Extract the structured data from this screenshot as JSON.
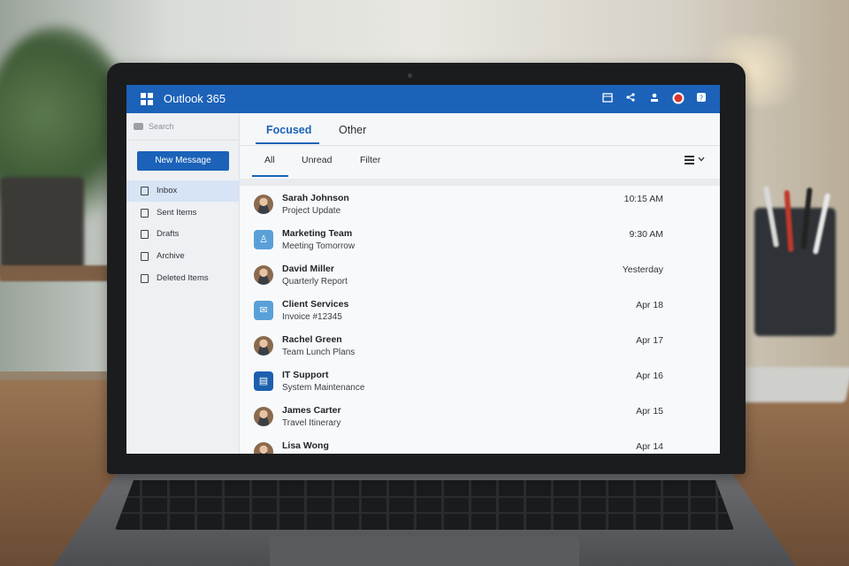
{
  "app": {
    "title": "Outlook 365"
  },
  "topbar_icons": [
    "calendar-icon",
    "share-icon",
    "person-icon",
    "notification-icon",
    "help-icon"
  ],
  "sidebar": {
    "search_placeholder": "Search",
    "new_message_label": "New Message",
    "folders": [
      {
        "label": "Inbox",
        "icon": "inbox-icon",
        "active": true
      },
      {
        "label": "Sent Items",
        "icon": "sent-icon",
        "active": false
      },
      {
        "label": "Drafts",
        "icon": "drafts-icon",
        "active": false
      },
      {
        "label": "Archive",
        "icon": "archive-icon",
        "active": false
      },
      {
        "label": "Deleted Items",
        "icon": "trash-icon",
        "active": false
      }
    ]
  },
  "main": {
    "tabs": [
      {
        "label": "Focused",
        "active": true
      },
      {
        "label": "Other",
        "active": false
      }
    ],
    "filters": [
      {
        "label": "All",
        "active": true
      },
      {
        "label": "Unread",
        "active": false
      },
      {
        "label": "Filter",
        "active": false
      }
    ],
    "messages": [
      {
        "sender": "Sarah Johnson",
        "subject": "Project Update",
        "time": "10:15 AM",
        "avatar": "person"
      },
      {
        "sender": "Marketing Team",
        "subject": "Meeting Tomorrow",
        "time": "9:30 AM",
        "avatar": "team"
      },
      {
        "sender": "David Miller",
        "subject": "Quarterly Report",
        "time": "Yesterday",
        "avatar": "person"
      },
      {
        "sender": "Client Services",
        "subject": "Invoice #12345",
        "time": "Apr 18",
        "avatar": "mail"
      },
      {
        "sender": "Rachel Green",
        "subject": "Team Lunch Plans",
        "time": "Apr 17",
        "avatar": "person"
      },
      {
        "sender": "IT Support",
        "subject": "System Maintenance",
        "time": "Apr 16",
        "avatar": "support"
      },
      {
        "sender": "James Carter",
        "subject": "Travel Itinerary",
        "time": "Apr 15",
        "avatar": "person"
      },
      {
        "sender": "Lisa Wong",
        "subject": "",
        "time": "Apr 14",
        "avatar": "person"
      }
    ]
  },
  "colors": {
    "accent": "#1b62b8",
    "topbar": "#1b62b8",
    "active_folder": "#d6e4f5"
  }
}
